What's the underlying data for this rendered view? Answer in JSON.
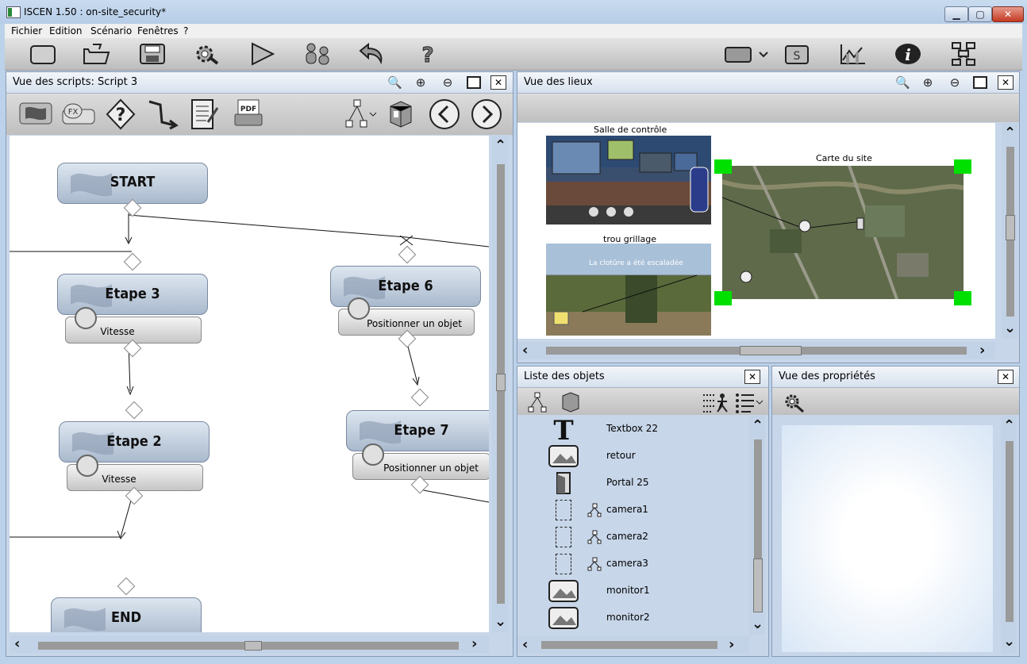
{
  "window": {
    "title": "ISCEN 1.50 : on-site_security*"
  },
  "menu": [
    "Fichier",
    "Edition",
    "Scénario",
    "Fenêtres",
    "?"
  ],
  "toolbar": {
    "left_icons": [
      "new-icon",
      "open-icon",
      "save-icon",
      "settings-icon",
      "play-icon",
      "users-icon",
      "undo-icon",
      "help-icon"
    ],
    "right_icons": [
      "screen-icon",
      "chevron-down-icon",
      "script-icon",
      "chart-icon",
      "info-icon",
      "network-icon"
    ]
  },
  "script_panel": {
    "title": "Vue des scripts: Script 3",
    "nodes": [
      {
        "title": "START"
      },
      {
        "title": "Etape 3",
        "action": "Vitesse"
      },
      {
        "title": "Etape 6",
        "action": "Positionner un objet"
      },
      {
        "title": "Etape 2",
        "action": "Vitesse"
      },
      {
        "title": "Etape 7",
        "action": "Positionner un objet"
      },
      {
        "title": "END"
      }
    ],
    "pdf_label": "PDF",
    "fx_label": "FX"
  },
  "places_panel": {
    "title": "Vue des lieux",
    "scenes": [
      {
        "label": "Salle de contrôle"
      },
      {
        "label": "Carte du site"
      },
      {
        "label": "trou grillage",
        "overlay_text": "La clotûre a été escaladée"
      }
    ]
  },
  "objects_panel": {
    "title": "Liste des objets",
    "items": [
      {
        "label": "Textbox 22",
        "icon": "textbox-icon"
      },
      {
        "label": "retour",
        "icon": "image-icon"
      },
      {
        "label": "Portal 25",
        "icon": "portal-icon"
      },
      {
        "label": "camera1",
        "icon": "camera-icon"
      },
      {
        "label": "camera2",
        "icon": "camera-icon"
      },
      {
        "label": "camera3",
        "icon": "camera-icon"
      },
      {
        "label": "monitor1",
        "icon": "image-icon"
      },
      {
        "label": "monitor2",
        "icon": "image-icon"
      }
    ]
  },
  "properties_panel": {
    "title": "Vue des propriétés"
  },
  "colors": {
    "accent": "#a9b9cd",
    "selection_handles": "#00e000",
    "window_frame": "#bcd2ea"
  }
}
